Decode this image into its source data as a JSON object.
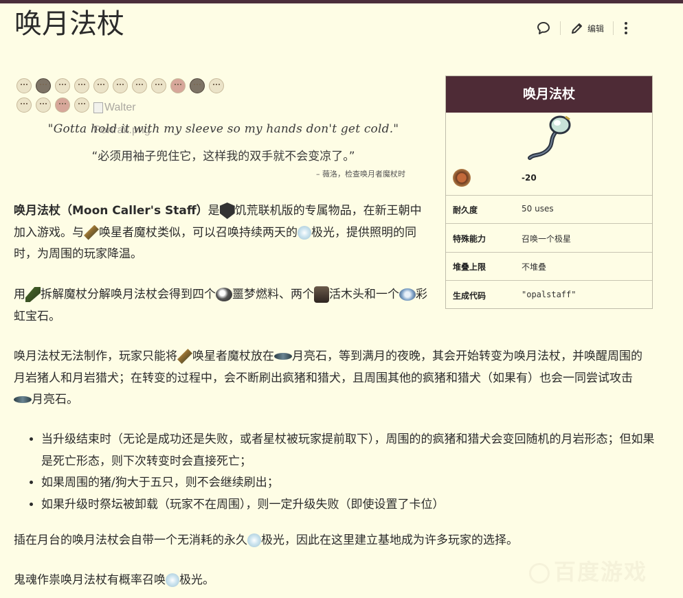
{
  "page": {
    "title": "唤月法杖"
  },
  "actions": {
    "edit_label": "编辑"
  },
  "portraits": {
    "alt_text": "Walter Portrait.png"
  },
  "quote": {
    "english": "\"Gotta hold it with my sleeve so my hands don't get cold.\"",
    "chinese": "“必须用袖子兜住它，这样我的双手就不会变凉了。”",
    "source": "– 薇洛，检查唤月者魔杖时"
  },
  "paragraphs": {
    "intro": {
      "name_bold": "唤月法杖（Moon Caller's Staff）",
      "t1": "是",
      "t2": "饥荒联机版的专属物品，在新王朝中加入游戏。与",
      "t3": "唤星者魔杖类似，可以召唤持续两天的",
      "t4": "极光，提供照明的同时，为周围的玩家降温。"
    },
    "deconstruct": {
      "t1": "用",
      "t2": "拆解魔杖分解唤月法杖会得到四个",
      "t3": "噩梦燃料、两个",
      "t4": "活木头和一个",
      "t5": "彩虹宝石。"
    },
    "obtain": {
      "t1": "唤月法杖无法制作，玩家只能将",
      "t2": "唤星者魔杖放在",
      "t3": "月亮石，等到满月的夜晚，其会开始转变为唤月法杖，并唤醒周围的月岩猪人和月岩猎犬；在转变的过程中，会不断刷出疯猪和猎犬，且周围其他的疯猪和猎犬（如果有）也会一同尝试攻击",
      "t4": "月亮石。"
    },
    "bullets": [
      "当升级结束时（无论是成功还是失败，或者星杖被玩家提前取下），周围的的疯猪和猎犬会变回随机的月岩形态；但如果是死亡形态，则下次转变时会直接死亡；",
      "如果周围的猪/狗大于五只，则不会继续刷出；",
      "如果升级时祭坛被卸载（玩家不在周围），则一定升级失败（即使设置了卡位）"
    ],
    "moon_altar": {
      "t1": "插在月台的唤月法杖会自带一个无消耗的永久",
      "t2": "极光，因此在这里建立基地成为许多玩家的选择。"
    },
    "ghost": {
      "t1": "鬼魂作祟唤月法杖有概率召唤",
      "t2": "极光。"
    }
  },
  "infobox": {
    "title": "唤月法杖",
    "damage": "-20",
    "rows": [
      {
        "key": "耐久度",
        "value": "50 uses"
      },
      {
        "key": "特殊能力",
        "value": "召唤一个极星"
      },
      {
        "key": "堆叠上限",
        "value": "不堆叠"
      },
      {
        "key": "生成代码",
        "value": "\"opalstaff\""
      }
    ]
  },
  "watermark": {
    "text": "百度游戏"
  },
  "colors": {
    "header": "#4e2b36",
    "background": "#fefde5",
    "topbar": "#4b2e3b"
  }
}
